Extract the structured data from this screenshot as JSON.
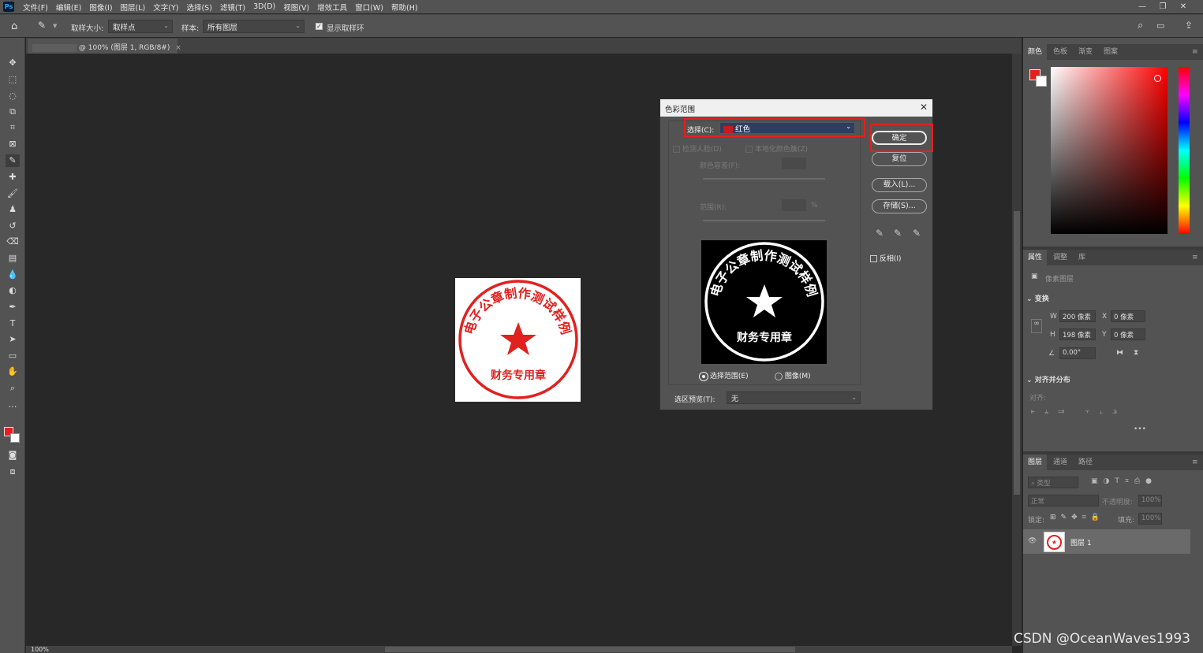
{
  "app": {
    "logo": "Ps"
  },
  "menu": [
    "文件(F)",
    "编辑(E)",
    "图像(I)",
    "图层(L)",
    "文字(Y)",
    "选择(S)",
    "滤镜(T)",
    "3D(D)",
    "视图(V)",
    "增效工具",
    "窗口(W)",
    "帮助(H)"
  ],
  "options": {
    "sample_size_label": "取样大小:",
    "sample_size_value": "取样点",
    "sample_label": "样本:",
    "sample_value": "所有图层",
    "show_ring_label": "显示取样环"
  },
  "document": {
    "tab_title": "@ 100% (图层 1, RGB/8#)",
    "zoom": "100%"
  },
  "stamp": {
    "arc_text": "电子公章制作测试样例",
    "bottom_text": "财务专用章",
    "color": "#e0211f"
  },
  "dialog": {
    "title": "色彩范围",
    "select_label": "选择(C):",
    "select_value": "红色",
    "detect_faces": "检测人脸(D)",
    "localized": "本地化颜色簇(Z)",
    "fuzziness": "颜色容差(F):",
    "range": "范围(R):",
    "percent": "%",
    "radio_selection": "选择范围(E)",
    "radio_image": "图像(M)",
    "preview_label": "选区预览(T):",
    "preview_value": "无",
    "ok": "确定",
    "reset": "复位",
    "load": "载入(L)...",
    "save": "存储(S)...",
    "invert": "反相(I)"
  },
  "panels": {
    "color_tabs": [
      "颜色",
      "色板",
      "渐变",
      "图案"
    ],
    "props_tabs": [
      "属性",
      "调整",
      "库"
    ],
    "pixel_layer": "像素图层",
    "transform": "变换",
    "w_label": "W",
    "w_value": "200 像素",
    "h_label": "H",
    "h_value": "198 像素",
    "x_label": "X",
    "x_value": "0 像素",
    "y_label": "Y",
    "y_value": "0 像素",
    "angle": "0.00°",
    "align": "对齐并分布",
    "align_sub": "对齐:",
    "layers_tabs": [
      "图层",
      "通道",
      "路径"
    ],
    "kind": "类型",
    "blend": "正常",
    "opacity_label": "不透明度:",
    "opacity_value": "100%",
    "lock_label": "锁定:",
    "fill_label": "填充:",
    "fill_value": "100%",
    "layer_name": "图层 1"
  },
  "watermark": "CSDN @OceanWaves1993",
  "colors": {
    "foreground": "#e0211f",
    "background": "#ffffff",
    "highlight": "#e0211f"
  }
}
